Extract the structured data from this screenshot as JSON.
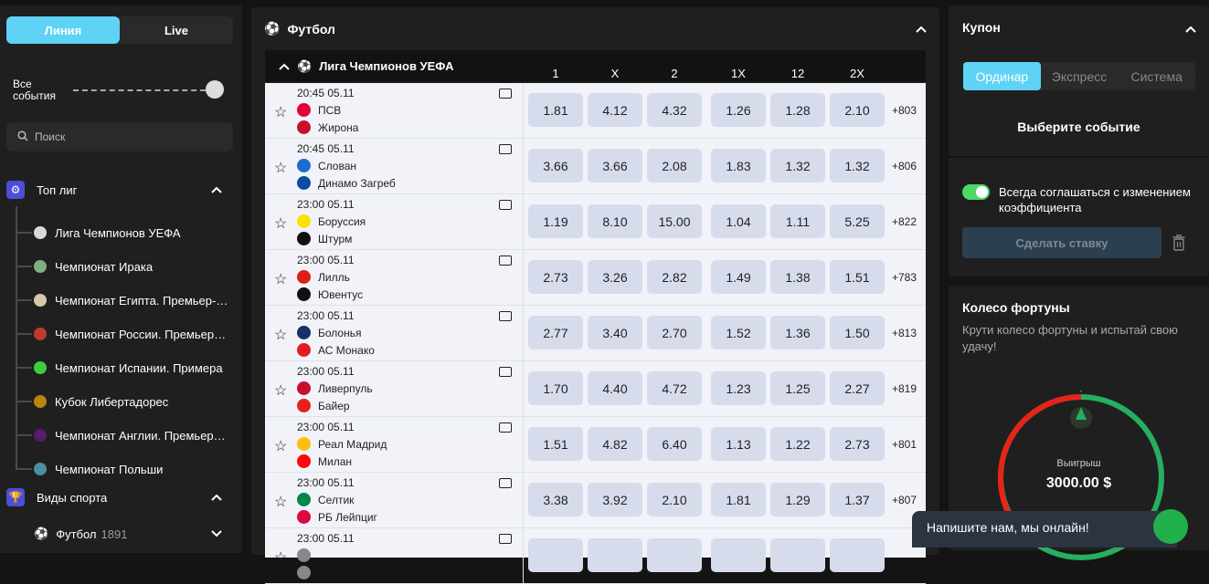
{
  "sidebar": {
    "tabs": [
      "Линия",
      "Live"
    ],
    "range_label_1": "Все",
    "range_label_2": "события",
    "search_placeholder": "Поиск",
    "top_leagues": "Топ лиг",
    "leagues": [
      "Лига Чемпионов УЕФА",
      "Чемпионат Ирака",
      "Чемпионат Египта. Премьер-лига",
      "Чемпионат России. Премьер-лига",
      "Чемпионат Испании. Примера",
      "Кубок Либертадорес",
      "Чемпионат Англии. Премьер-лига",
      "Чемпионат Польши"
    ],
    "sports": "Виды спорта",
    "football": "Футбол",
    "football_count": "1891"
  },
  "main": {
    "title": "Футбол",
    "league": "Лига Чемпионов УЕФА",
    "columns": [
      "1",
      "X",
      "2",
      "1X",
      "12",
      "2X"
    ],
    "matches": [
      {
        "time": "20:45 05.11",
        "team1": "ПСВ",
        "team2": "Жирона",
        "odds": [
          "1.81",
          "4.12",
          "4.32",
          "1.26",
          "1.28",
          "2.10"
        ],
        "more": "+803",
        "c1": "#e4003a",
        "c2": "#c8102e"
      },
      {
        "time": "20:45 05.11",
        "team1": "Слован",
        "team2": "Динамо Загреб",
        "odds": [
          "3.66",
          "3.66",
          "2.08",
          "1.83",
          "1.32",
          "1.32"
        ],
        "more": "+806",
        "c1": "#1c6dd0",
        "c2": "#0a4ea2"
      },
      {
        "time": "23:00 05.11",
        "team1": "Боруссия",
        "team2": "Штурм",
        "odds": [
          "1.19",
          "8.10",
          "15.00",
          "1.04",
          "1.11",
          "5.25"
        ],
        "more": "+822",
        "c1": "#fde100",
        "c2": "#111111"
      },
      {
        "time": "23:00 05.11",
        "team1": "Лилль",
        "team2": "Ювентус",
        "odds": [
          "2.73",
          "3.26",
          "2.82",
          "1.49",
          "1.38",
          "1.51"
        ],
        "more": "+783",
        "c1": "#e01e13",
        "c2": "#111111"
      },
      {
        "time": "23:00 05.11",
        "team1": "Болонья",
        "team2": "АС Монако",
        "odds": [
          "2.77",
          "3.40",
          "2.70",
          "1.52",
          "1.36",
          "1.50"
        ],
        "more": "+813",
        "c1": "#1a2f6e",
        "c2": "#e51b22"
      },
      {
        "time": "23:00 05.11",
        "team1": "Ливерпуль",
        "team2": "Байер",
        "odds": [
          "1.70",
          "4.40",
          "4.72",
          "1.23",
          "1.25",
          "2.27"
        ],
        "more": "+819",
        "c1": "#c8102e",
        "c2": "#e32219"
      },
      {
        "time": "23:00 05.11",
        "team1": "Реал Мадрид",
        "team2": "Милан",
        "odds": [
          "1.51",
          "4.82",
          "6.40",
          "1.13",
          "1.22",
          "2.73"
        ],
        "more": "+801",
        "c1": "#febe10",
        "c2": "#fb090b"
      },
      {
        "time": "23:00 05.11",
        "team1": "Селтик",
        "team2": "РБ Лейпциг",
        "odds": [
          "3.38",
          "3.92",
          "2.10",
          "1.81",
          "1.29",
          "1.37"
        ],
        "more": "+807",
        "c1": "#018749",
        "c2": "#dd0741"
      },
      {
        "time": "23:00 05.11",
        "team1": "",
        "team2": "",
        "odds": [
          "",
          "",
          "",
          "",
          "",
          ""
        ],
        "more": "",
        "c1": "#888888",
        "c2": "#888888"
      }
    ]
  },
  "coupon": {
    "title": "Купон",
    "tabs": [
      "Ординар",
      "Экспресс",
      "Система"
    ],
    "choose": "Выберите событие",
    "accept": "Всегда соглашаться с изменением коэффициента",
    "bet_button": "Сделать ставку"
  },
  "wheel": {
    "title": "Колесо фортуны",
    "subtitle": "Крути колесо фортуны и испытай свою удачу!",
    "win_label": "Выигрыш",
    "win_value": "3000.00 $"
  },
  "chat": {
    "text": "Напишите нам, мы онлайн!"
  },
  "colors": {
    "accent": "#5ed3f5",
    "odds_bg": "#d7dced",
    "league_icons": [
      "#d8d8d8",
      "#7fb07f",
      "#d8c8a8",
      "#c0392b",
      "#3ecf3e",
      "#b8860b",
      "#5a1b6b",
      "#4a90a4"
    ]
  }
}
